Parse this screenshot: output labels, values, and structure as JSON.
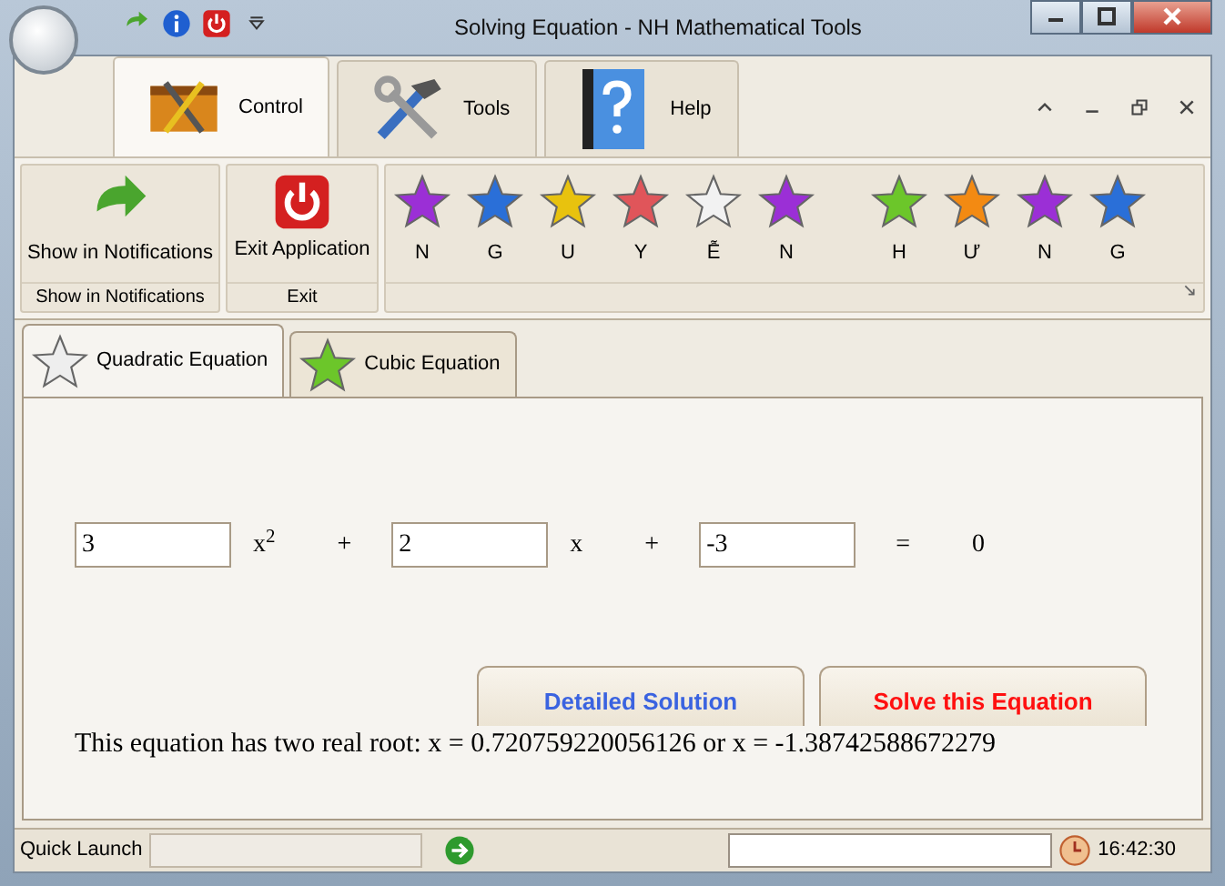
{
  "window": {
    "title": "Solving Equation - NH Mathematical Tools"
  },
  "quick_access": [
    {
      "kind": "redo"
    },
    {
      "kind": "info"
    },
    {
      "kind": "power"
    },
    {
      "kind": "dropdown"
    }
  ],
  "ribbon_tabs": [
    {
      "label": "Control",
      "selected": true
    },
    {
      "label": "Tools",
      "selected": false
    },
    {
      "label": "Help",
      "selected": false
    }
  ],
  "ribbon_groups": [
    {
      "button": "Show in Notifications",
      "caption": "Show in Notifications"
    },
    {
      "button": "Exit Application",
      "caption": "Exit"
    }
  ],
  "star_words": [
    [
      {
        "label": "N",
        "color": "#9b2fd6"
      },
      {
        "label": "G",
        "color": "#2a6fd8"
      },
      {
        "label": "U",
        "color": "#e8c20e"
      },
      {
        "label": "Y",
        "color": "#e0555a"
      },
      {
        "label": "Ễ",
        "color": "#f2f2f2"
      },
      {
        "label": "N",
        "color": "#9b2fd6"
      }
    ],
    [
      {
        "label": "H",
        "color": "#6cc62a"
      },
      {
        "label": "Ư",
        "color": "#f38a12"
      },
      {
        "label": "N",
        "color": "#9b2fd6"
      },
      {
        "label": "G",
        "color": "#2a6fd8"
      }
    ]
  ],
  "doc_tabs": [
    {
      "label": "Quadratic Equation",
      "selected": true,
      "color": "#eeeeee"
    },
    {
      "label": "Cubic Equation",
      "selected": false,
      "color": "#6cc62a"
    }
  ],
  "equation": [
    {
      "kind": "field",
      "value": "3"
    },
    {
      "kind": "term",
      "text": "x$^{2}$"
    },
    {
      "kind": "op",
      "text": "+"
    },
    {
      "kind": "field",
      "value": "2"
    },
    {
      "kind": "term",
      "text": "x"
    },
    {
      "kind": "op",
      "text": "+"
    },
    {
      "kind": "field",
      "value": "-3"
    },
    {
      "kind": "op",
      "text": "="
    },
    {
      "kind": "term",
      "text": "0"
    }
  ],
  "buttons": [
    {
      "label": "Detailed Solution",
      "color": "#3a63e0"
    },
    {
      "label": "Solve this Equation",
      "color": "#ff1010"
    }
  ],
  "result": "This equation has two real root:  x = 0.720759220056126  or  x = -1.38742588672279",
  "status_bar": {
    "quick_launch": "Quick Launch",
    "time": "16:42:30"
  }
}
